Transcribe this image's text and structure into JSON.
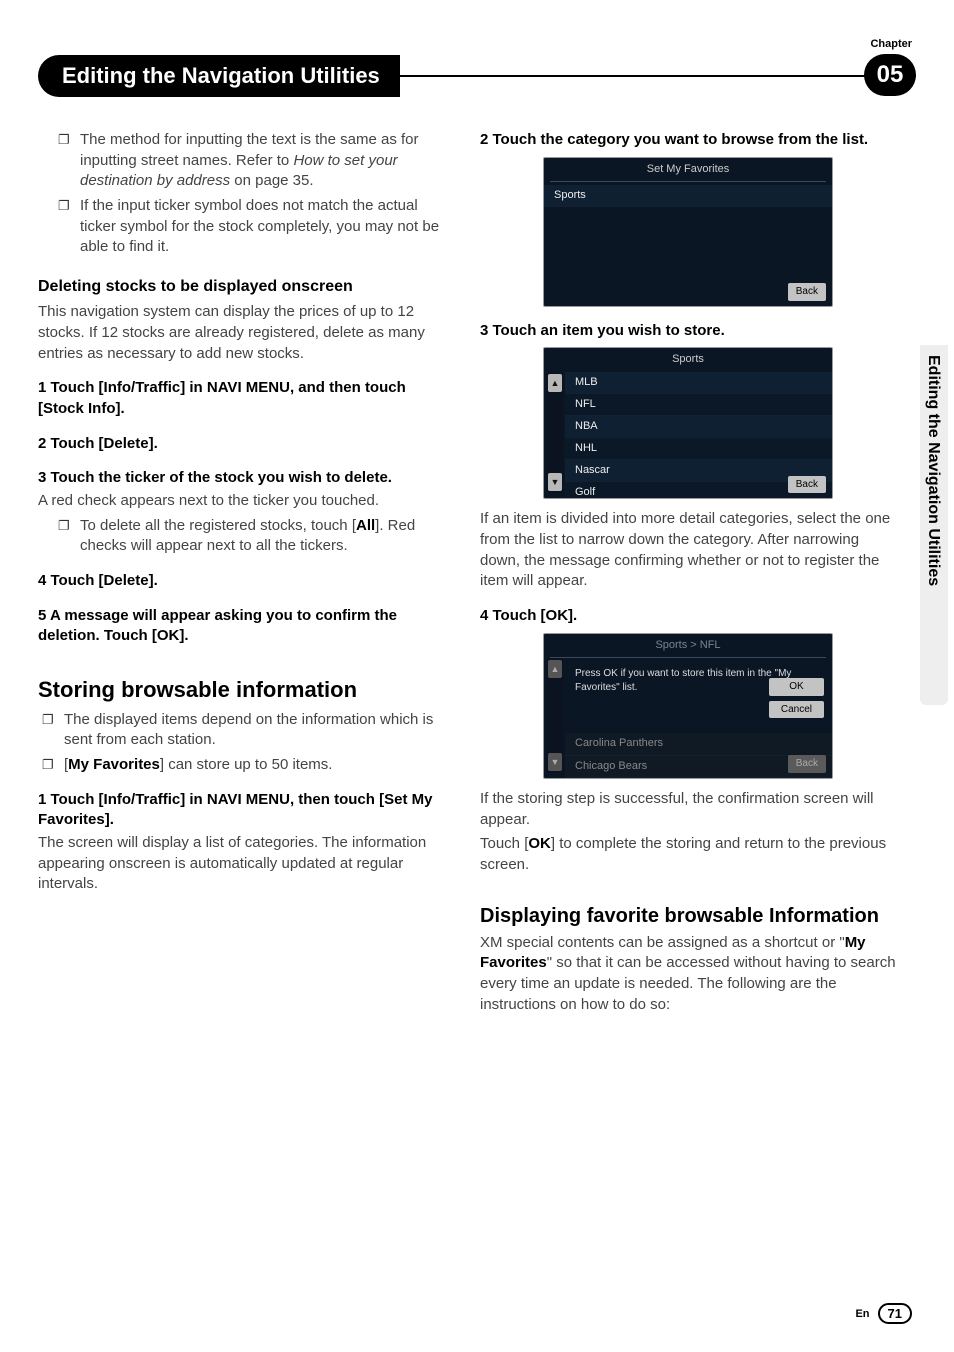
{
  "header": {
    "chapter_word": "Chapter",
    "title": "Editing the Navigation Utilities",
    "chapter_num": "05"
  },
  "side_tab": "Editing the Navigation Utilities",
  "left": {
    "bullets_top": [
      {
        "pre": "The method for inputting the text is the same as for inputting street names. Refer to ",
        "italic": "How to set your destination by address",
        "post": " on page 35."
      },
      {
        "text": "If the input ticker symbol does not match the actual ticker symbol for the stock completely, you may not be able to find it."
      }
    ],
    "del_heading": "Deleting stocks to be displayed onscreen",
    "del_intro": "This navigation system can display the prices of up to 12 stocks. If 12 stocks are already registered, delete as many entries as necessary to add new stocks.",
    "step1": "1    Touch [Info/Traffic] in NAVI MENU, and then touch [Stock Info].",
    "step2": "2    Touch [Delete].",
    "step3": "3    Touch the ticker of the stock you wish to delete.",
    "step3_body": "A red check appears next to the ticker you touched.",
    "step3_bullet": {
      "pre": "To delete all the registered stocks, touch [",
      "all": "All",
      "post": "]. Red checks will appear next to all the tickers."
    },
    "step4": "4    Touch [Delete].",
    "step5": "5    A message will appear asking you to confirm the deletion. Touch [OK].",
    "storing_heading": "Storing browsable information",
    "storing_bullets": [
      {
        "text": "The displayed items depend on the information which is sent from each station."
      },
      {
        "pre": "[",
        "bold": "My Favorites",
        "post": "] can store up to 50 items."
      }
    ],
    "storing_step1": "1    Touch [Info/Traffic] in NAVI MENU, then touch [Set My Favorites].",
    "storing_step1_body": "The screen will display a list of categories. The information appearing onscreen is automatically updated at regular intervals."
  },
  "right": {
    "step2": "2    Touch the category you want to browse from the list.",
    "shot1": {
      "title": "Set My Favorites",
      "items": [
        "Sports"
      ],
      "back": "Back"
    },
    "step3": "3    Touch an item you wish to store.",
    "shot2": {
      "title": "Sports",
      "items": [
        "MLB",
        "NFL",
        "NBA",
        "NHL",
        "Nascar",
        "Golf"
      ],
      "back": "Back"
    },
    "after2": "If an item is divided into more detail categories, select the one from the list to narrow down the category. After narrowing down, the message confirming whether or not to register the item will appear.",
    "step4": "4    Touch [OK].",
    "shot3": {
      "title": "Sports > NFL",
      "msg": "Press OK if you want to store this item in the \"My Favorites\" list.",
      "ok": "OK",
      "cancel": "Cancel",
      "dim1": "Carolina Panthers",
      "dim2": "Chicago Bears",
      "back": "Back"
    },
    "after3a": "If the storing step is successful, the confirmation screen will appear.",
    "after3b_pre": "Touch [",
    "after3b_bold": "OK",
    "after3b_post": "] to complete the storing and return to the previous screen.",
    "disp_heading": "Displaying favorite browsable Information",
    "disp_body_pre": "XM special contents can be assigned as a shortcut or \"",
    "disp_body_bold": "My Favorites",
    "disp_body_post": "\" so that it can be accessed without having to search every time an update is needed. The following are the instructions on how to do so:"
  },
  "footer": {
    "lang": "En",
    "page": "71"
  }
}
